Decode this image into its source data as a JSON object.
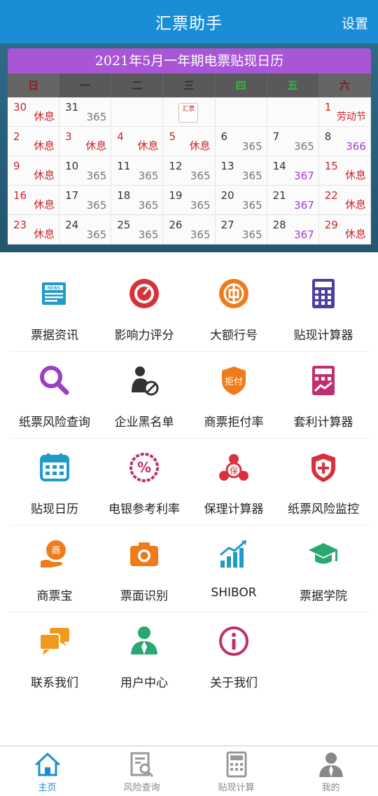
{
  "header": {
    "title": "汇票助手",
    "settings_label": "设置"
  },
  "calendar": {
    "title": "2021年5月一年期电票贴现日历",
    "weekdays": [
      "日",
      "一",
      "二",
      "三",
      "四",
      "五",
      "六"
    ],
    "logo_text": "汇票",
    "rows": [
      [
        {
          "d": "30",
          "t": "休息",
          "h": true
        },
        {
          "d": "31",
          "t": "365"
        },
        {
          "d": "",
          "t": ""
        },
        {
          "d": "",
          "t": "",
          "logo": true
        },
        {
          "d": "",
          "t": ""
        },
        {
          "d": "",
          "t": ""
        },
        {
          "d": "1",
          "t": "劳动节",
          "h": true
        }
      ],
      [
        {
          "d": "2",
          "t": "休息",
          "h": true
        },
        {
          "d": "3",
          "t": "休息",
          "h": true
        },
        {
          "d": "4",
          "t": "休息",
          "h": true
        },
        {
          "d": "5",
          "t": "休息",
          "h": true
        },
        {
          "d": "6",
          "t": "365"
        },
        {
          "d": "7",
          "t": "365"
        },
        {
          "d": "8",
          "t": "366",
          "p": true
        }
      ],
      [
        {
          "d": "9",
          "t": "休息",
          "h": true
        },
        {
          "d": "10",
          "t": "365"
        },
        {
          "d": "11",
          "t": "365"
        },
        {
          "d": "12",
          "t": "365"
        },
        {
          "d": "13",
          "t": "365"
        },
        {
          "d": "14",
          "t": "367",
          "p": true
        },
        {
          "d": "15",
          "t": "休息",
          "h": true
        }
      ],
      [
        {
          "d": "16",
          "t": "休息",
          "h": true
        },
        {
          "d": "17",
          "t": "365"
        },
        {
          "d": "18",
          "t": "365"
        },
        {
          "d": "19",
          "t": "365"
        },
        {
          "d": "20",
          "t": "365"
        },
        {
          "d": "21",
          "t": "367",
          "p": true
        },
        {
          "d": "22",
          "t": "休息",
          "h": true
        }
      ],
      [
        {
          "d": "23",
          "t": "休息",
          "h": true
        },
        {
          "d": "24",
          "t": "365"
        },
        {
          "d": "25",
          "t": "365"
        },
        {
          "d": "26",
          "t": "365"
        },
        {
          "d": "27",
          "t": "365"
        },
        {
          "d": "28",
          "t": "367",
          "p": true
        },
        {
          "d": "29",
          "t": "休息",
          "h": true
        }
      ]
    ]
  },
  "menu": [
    [
      {
        "label": "票据资讯",
        "icon": "news-icon"
      },
      {
        "label": "影响力评分",
        "icon": "gauge-icon"
      },
      {
        "label": "大额行号",
        "icon": "bank-icon"
      },
      {
        "label": "贴现计算器",
        "icon": "calculator-icon"
      }
    ],
    [
      {
        "label": "纸票风险查询",
        "icon": "search-icon"
      },
      {
        "label": "企业黑名单",
        "icon": "blocked-user-icon"
      },
      {
        "label": "商票拒付率",
        "icon": "refuse-shield-icon"
      },
      {
        "label": "套利计算器",
        "icon": "chart-calculator-icon"
      }
    ],
    [
      {
        "label": "贴现日历",
        "icon": "calendar-icon"
      },
      {
        "label": "电银参考利率",
        "icon": "percent-badge-icon"
      },
      {
        "label": "保理计算器",
        "icon": "factoring-icon"
      },
      {
        "label": "纸票风险监控",
        "icon": "shield-cross-icon"
      }
    ],
    [
      {
        "label": "商票宝",
        "icon": "hand-coin-icon"
      },
      {
        "label": "票面识别",
        "icon": "camera-icon"
      },
      {
        "label": "SHIBOR",
        "icon": "bar-trend-icon"
      },
      {
        "label": "票据学院",
        "icon": "graduation-cap-icon"
      }
    ],
    [
      {
        "label": "联系我们",
        "icon": "chat-icon"
      },
      {
        "label": "用户中心",
        "icon": "user-icon"
      },
      {
        "label": "关于我们",
        "icon": "info-icon"
      }
    ]
  ],
  "tabs": [
    {
      "label": "主页",
      "icon": "home-icon",
      "active": true
    },
    {
      "label": "风险查询",
      "icon": "doc-search-icon"
    },
    {
      "label": "贴现计算",
      "icon": "calculator-icon"
    },
    {
      "label": "我的",
      "icon": "profile-icon"
    }
  ],
  "colors": {
    "primary": "#1b8cd6",
    "calendar_header": "#a855d6",
    "holiday": "#c9262b",
    "purple": "#a43ad0"
  }
}
